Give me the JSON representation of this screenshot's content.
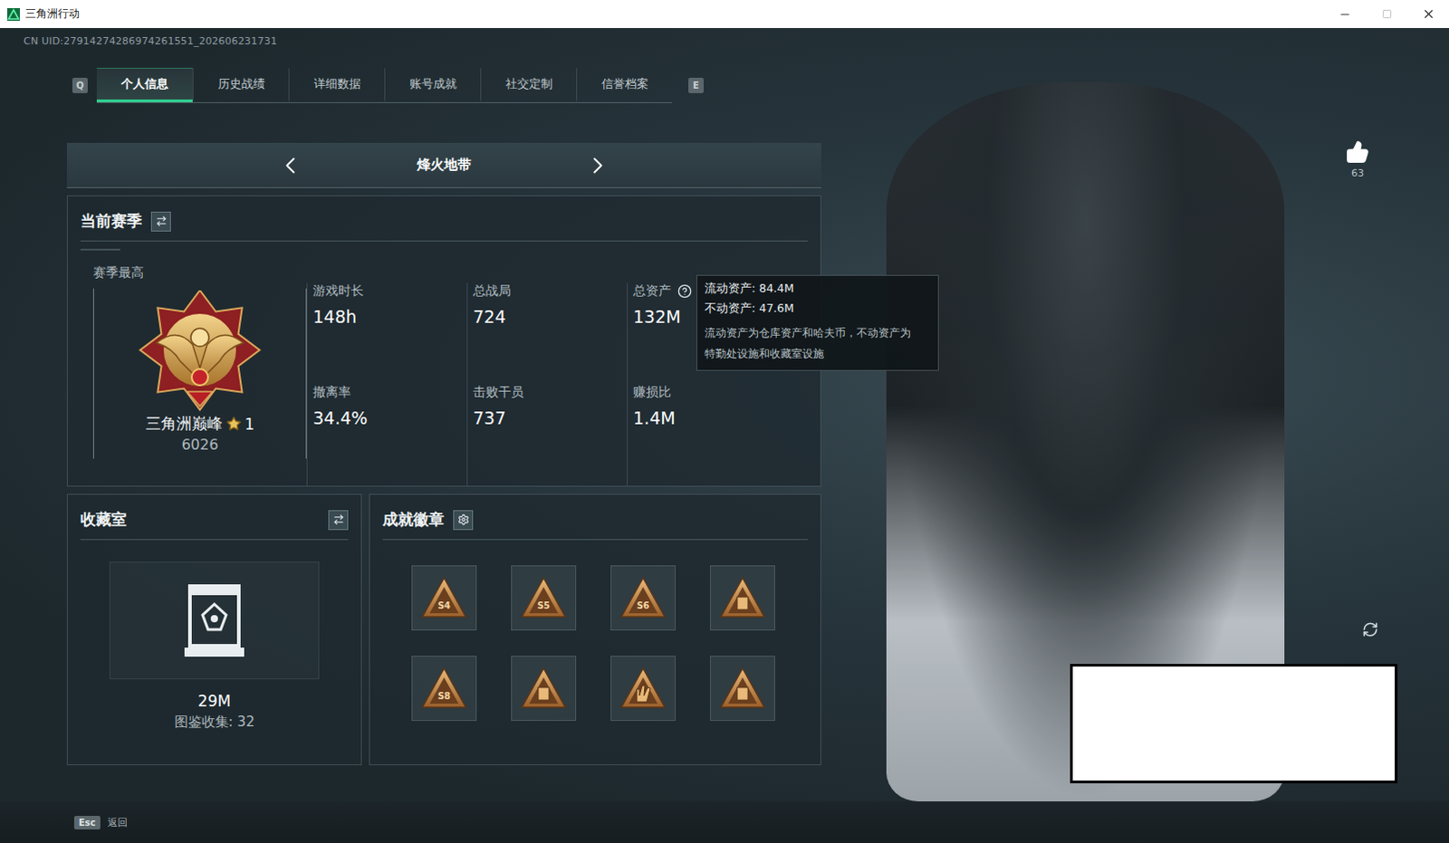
{
  "window": {
    "title": "三角洲行动"
  },
  "uid": "CN UID:27914274286974261551_202606231731",
  "tab_keys": {
    "prev": "Q",
    "next": "E"
  },
  "tabs": [
    {
      "label": "个人信息",
      "selected": true
    },
    {
      "label": "历史战绩",
      "selected": false
    },
    {
      "label": "详细数据",
      "selected": false
    },
    {
      "label": "账号成就",
      "selected": false
    },
    {
      "label": "社交定制",
      "selected": false
    },
    {
      "label": "信誉档案",
      "selected": false
    }
  ],
  "mode": {
    "label": "烽火地带"
  },
  "season": {
    "title": "当前赛季",
    "best_label": "赛季最高",
    "rank": {
      "name": "三角洲巅峰",
      "stars_count": "1",
      "score": "6026"
    },
    "stats": [
      {
        "label": "游戏时长",
        "value": "148h",
        "help": false
      },
      {
        "label": "总战局",
        "value": "724",
        "help": false
      },
      {
        "label": "总资产",
        "value": "132M",
        "help": true
      },
      {
        "label": "撤离率",
        "value": "34.4%",
        "help": false
      },
      {
        "label": "击败干员",
        "value": "737",
        "help": false
      },
      {
        "label": "赚损比",
        "value": "1.4M",
        "help": false
      }
    ]
  },
  "tooltip": {
    "lines": [
      "流动资产: 84.4M",
      "不动资产: 47.6M"
    ],
    "description": [
      "流动资产为仓库资产和哈夫币，不动资产为",
      "特勤处设施和收藏室设施"
    ]
  },
  "collection": {
    "title": "收藏室",
    "value": "29M",
    "catalog": "图鉴收集: 32"
  },
  "achievements": {
    "title": "成就徽章",
    "badges": [
      {
        "kind": "season",
        "label": "S4"
      },
      {
        "kind": "season",
        "label": "S5"
      },
      {
        "kind": "season",
        "label": "S6"
      },
      {
        "kind": "emblem"
      },
      {
        "kind": "season",
        "label": "S8"
      },
      {
        "kind": "emblem"
      },
      {
        "kind": "hand"
      },
      {
        "kind": "emblem"
      }
    ]
  },
  "likes": "63",
  "footer": {
    "key": "Esc",
    "label": "返回"
  }
}
